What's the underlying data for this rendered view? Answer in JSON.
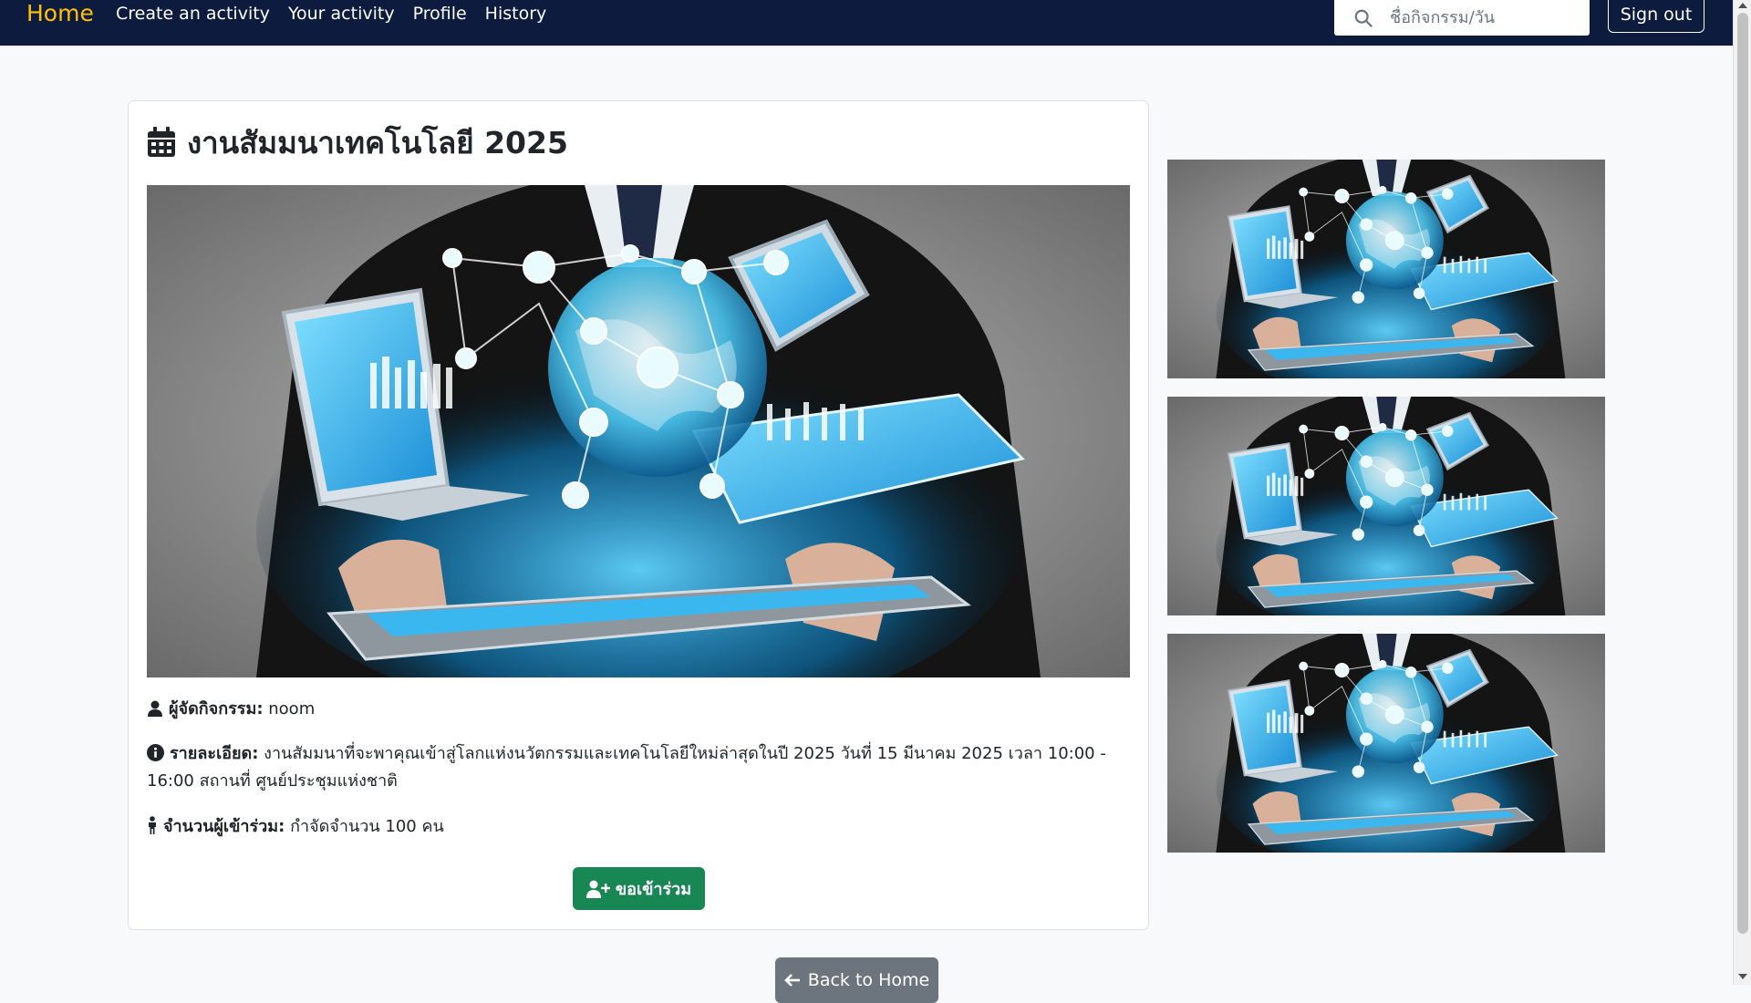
{
  "nav": {
    "brand": "Home",
    "links": [
      "Create an activity",
      "Your activity",
      "Profile",
      "History"
    ],
    "search_placeholder": "ชื่อกิจกรรม/วัน",
    "signout_label": "Sign out"
  },
  "event": {
    "title": "งานสัมมนาเทคโนโลยี 2025",
    "organizer_label": "ผู้จัดกิจกรรม:",
    "organizer_value": "noom",
    "details_label": "รายละเอียด:",
    "details_value": "งานสัมมนาที่จะพาคุณเข้าสู่โลกแห่งนวัตกรรมและเทคโนโลยีใหม่ล่าสุดในปี 2025 วันที่ 15 มีนาคม 2025 เวลา 10:00 - 16:00 สถานที่ ศูนย์ประชุมแห่งชาติ",
    "participants_label": "จำนวนผู้เข้าร่วม:",
    "participants_value": "กำจัดจำนวน 100 คน",
    "join_label": "ขอเข้าร่วม"
  },
  "back_label": "Back to Home",
  "colors": {
    "navbar": "#0d1b3e",
    "brand": "#ffc107",
    "join": "#198754",
    "back": "#6c757d"
  }
}
